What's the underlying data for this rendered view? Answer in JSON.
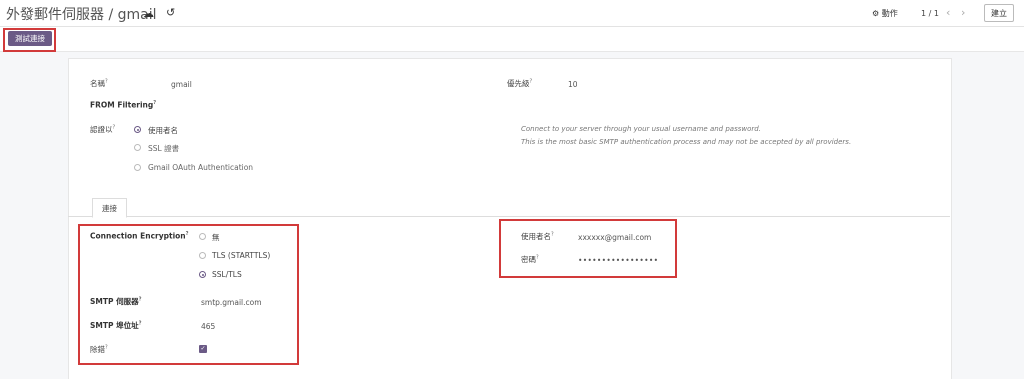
{
  "header": {
    "breadcrumb": "外發郵件伺服器 / gmail",
    "action_label": "動作",
    "pager": "1 / 1",
    "create_label": "建立"
  },
  "toolbar": {
    "test_connection_label": "測試連接"
  },
  "form": {
    "name_label": "名稱",
    "name_value": "gmail",
    "priority_label": "優先級",
    "priority_value": "10",
    "from_filtering_label": "FROM Filtering",
    "auth_label": "認證以",
    "auth_options": [
      "使用者名",
      "SSL 證書",
      "Gmail OAuth Authentication"
    ],
    "auth_selected": 0,
    "auth_hint_line1": "Connect to your server through your usual username and password.",
    "auth_hint_line2": "This is the most basic SMTP authentication process and may not be accepted by all providers."
  },
  "tabs": {
    "connection_label": "連接"
  },
  "connection": {
    "encryption_label": "Connection Encryption",
    "encryption_options": [
      "無",
      "TLS (STARTTLS)",
      "SSL/TLS"
    ],
    "encryption_selected": 2,
    "smtp_server_label": "SMTP 伺服器",
    "smtp_server_value": "smtp.gmail.com",
    "smtp_port_label": "SMTP 埠位址",
    "smtp_port_value": "465",
    "debug_label": "除錯",
    "debug_checked": true,
    "username_label": "使用者名",
    "username_value": "xxxxxx@gmail.com",
    "password_label": "密碼",
    "password_value": "•••••••••••••••••"
  },
  "colors": {
    "primary": "#6b5a86",
    "highlight": "#d23a3a"
  }
}
